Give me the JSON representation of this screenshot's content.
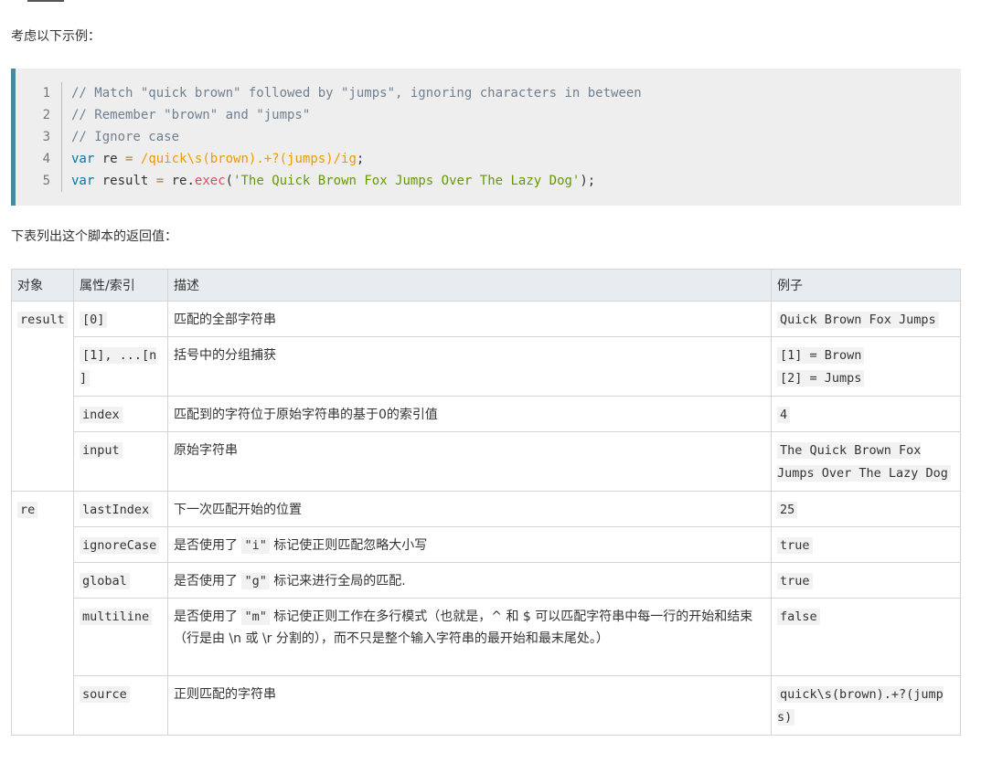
{
  "intro_text": "考虑以下示例：",
  "code": {
    "lines": [
      {
        "num": "1",
        "tokens": [
          {
            "t": "// Match \"quick brown\" followed by \"jumps\", ignoring characters in between",
            "k": "comment"
          }
        ]
      },
      {
        "num": "2",
        "tokens": [
          {
            "t": "// Remember \"brown\" and \"jumps\"",
            "k": "comment"
          }
        ]
      },
      {
        "num": "3",
        "tokens": [
          {
            "t": "// Ignore case",
            "k": "comment"
          }
        ]
      },
      {
        "num": "4",
        "tokens": [
          {
            "t": "var",
            "k": "keyword"
          },
          {
            "t": " re ",
            "k": "plain"
          },
          {
            "t": "=",
            "k": "op"
          },
          {
            "t": " ",
            "k": "plain"
          },
          {
            "t": "/quick\\s(brown).+?(jumps)/ig",
            "k": "regex"
          },
          {
            "t": ";",
            "k": "plain"
          }
        ]
      },
      {
        "num": "5",
        "tokens": [
          {
            "t": "var",
            "k": "keyword"
          },
          {
            "t": " result ",
            "k": "plain"
          },
          {
            "t": "=",
            "k": "op"
          },
          {
            "t": " re",
            "k": "plain"
          },
          {
            "t": ".",
            "k": "plain"
          },
          {
            "t": "exec",
            "k": "func"
          },
          {
            "t": "(",
            "k": "plain"
          },
          {
            "t": "'The Quick Brown Fox Jumps Over The Lazy Dog'",
            "k": "string"
          },
          {
            "t": ");",
            "k": "plain"
          }
        ]
      }
    ]
  },
  "outro_text": "下表列出这个脚本的返回值：",
  "table": {
    "headers": [
      "对象",
      "属性/索引",
      "描述",
      "例子"
    ],
    "result_label": "result",
    "re_label": "re",
    "rows": {
      "r0": {
        "prop": "[0]",
        "desc": "匹配的全部字符串",
        "ex": "Quick Brown Fox Jumps"
      },
      "r1": {
        "prop": "[1], ...[n ]",
        "desc": "括号中的分组捕获",
        "ex1": "[1] = Brown",
        "ex2": "[2] = Jumps"
      },
      "r2": {
        "prop": "index",
        "desc": "匹配到的字符位于原始字符串的基于0的索引值",
        "ex": "4"
      },
      "r3": {
        "prop": "input",
        "desc": "原始字符串",
        "ex": "The Quick Brown Fox Jumps Over The Lazy Dog"
      },
      "r4": {
        "prop": "lastIndex",
        "desc": "下一次匹配开始的位置",
        "ex": "25"
      },
      "r5": {
        "prop": "ignoreCase",
        "desc_pre": "是否使用了 ",
        "desc_code": "\"i\"",
        "desc_post": " 标记使正则匹配忽略大小写",
        "ex": "true"
      },
      "r6": {
        "prop": "global",
        "desc_pre": "是否使用了 ",
        "desc_code": "\"g\"",
        "desc_post": " 标记来进行全局的匹配.",
        "ex": "true"
      },
      "r7": {
        "prop": "multiline",
        "desc_pre": "是否使用了 ",
        "desc_code": "\"m\"",
        "desc_post": " 标记使正则工作在多行模式（也就是，^ 和 $ 可以匹配字符串中每一行的开始和结束（行是由 \\n 或 \\r 分割的），而不只是整个输入字符串的最开始和最末尾处。）",
        "ex": "false"
      },
      "r8": {
        "prop": "source",
        "desc": "正则匹配的字符串",
        "ex": "quick\\s(brown).+?(jumps)"
      }
    }
  }
}
